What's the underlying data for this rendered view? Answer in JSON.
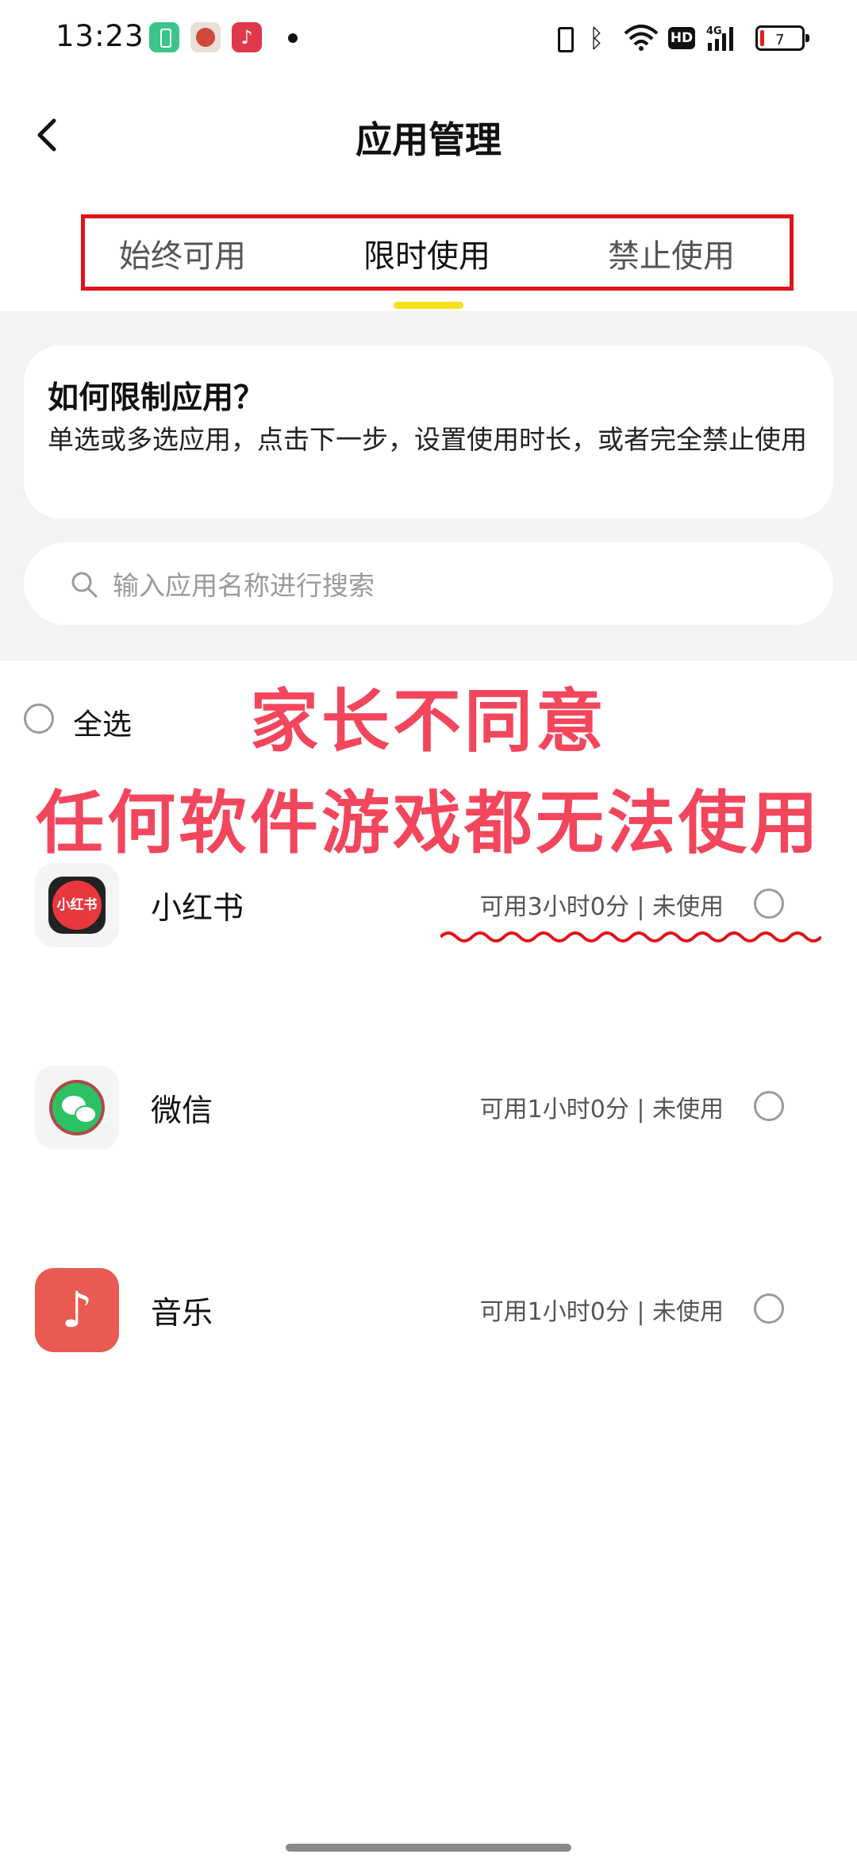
{
  "status_bar": {
    "time": "13:23",
    "battery_level": "7",
    "network_type": "4G",
    "hd_label": "HD",
    "icons": [
      "battery-saver-icon",
      "app-notification-icon",
      "music-notification-icon",
      "vibrate-icon",
      "bluetooth-icon",
      "wifi-icon",
      "hd-icon",
      "signal-icon",
      "battery-icon"
    ]
  },
  "header": {
    "title": "应用管理",
    "back_icon": "chevron-left-icon"
  },
  "tabs": [
    {
      "label": "始终可用",
      "active": false
    },
    {
      "label": "限时使用",
      "active": true
    },
    {
      "label": "禁止使用",
      "active": false
    }
  ],
  "info_card": {
    "title": "如何限制应用？",
    "description": "单选或多选应用，点击下一步，设置使用时长，或者完全禁止使用"
  },
  "search": {
    "placeholder": "输入应用名称进行搜索"
  },
  "select_all": {
    "label": "全选"
  },
  "overlay": {
    "line1": "家长不同意",
    "line2": "任何软件游戏都无法使用"
  },
  "apps": [
    {
      "name": "小红书",
      "status": "可用3小时0分 | 未使用",
      "icon_text": "小红书"
    },
    {
      "name": "微信",
      "status": "可用1小时0分 | 未使用"
    },
    {
      "name": "音乐",
      "status": "可用1小时0分 | 未使用"
    }
  ],
  "colors": {
    "accent": "#f5e21b",
    "highlight_box": "#e0121a",
    "overlay_text": "#f2465c",
    "background_grey": "#f3f3f3"
  }
}
